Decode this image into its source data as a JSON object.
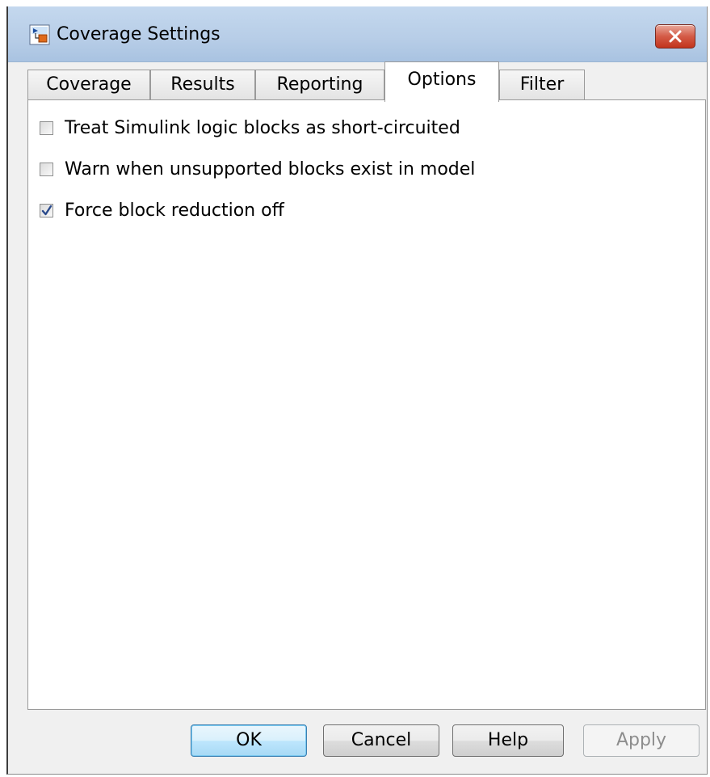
{
  "window": {
    "title": "Coverage Settings",
    "icon": "simulink-model-icon",
    "close_icon": "close-icon"
  },
  "tabs": [
    {
      "label": "Coverage",
      "active": false
    },
    {
      "label": "Results",
      "active": false
    },
    {
      "label": "Reporting",
      "active": false
    },
    {
      "label": "Options",
      "active": true
    },
    {
      "label": "Filter",
      "active": false
    }
  ],
  "options": [
    {
      "label": "Treat Simulink logic blocks as short-circuited",
      "checked": false
    },
    {
      "label": "Warn when unsupported blocks exist in model",
      "checked": false
    },
    {
      "label": "Force block reduction off",
      "checked": true
    }
  ],
  "buttons": {
    "ok": "OK",
    "cancel": "Cancel",
    "help": "Help",
    "apply": "Apply"
  },
  "colors": {
    "titlebar": "#b7cde7",
    "close_button": "#c2341c",
    "default_button": "#bee6fd",
    "check_mark": "#2a4a8c"
  }
}
